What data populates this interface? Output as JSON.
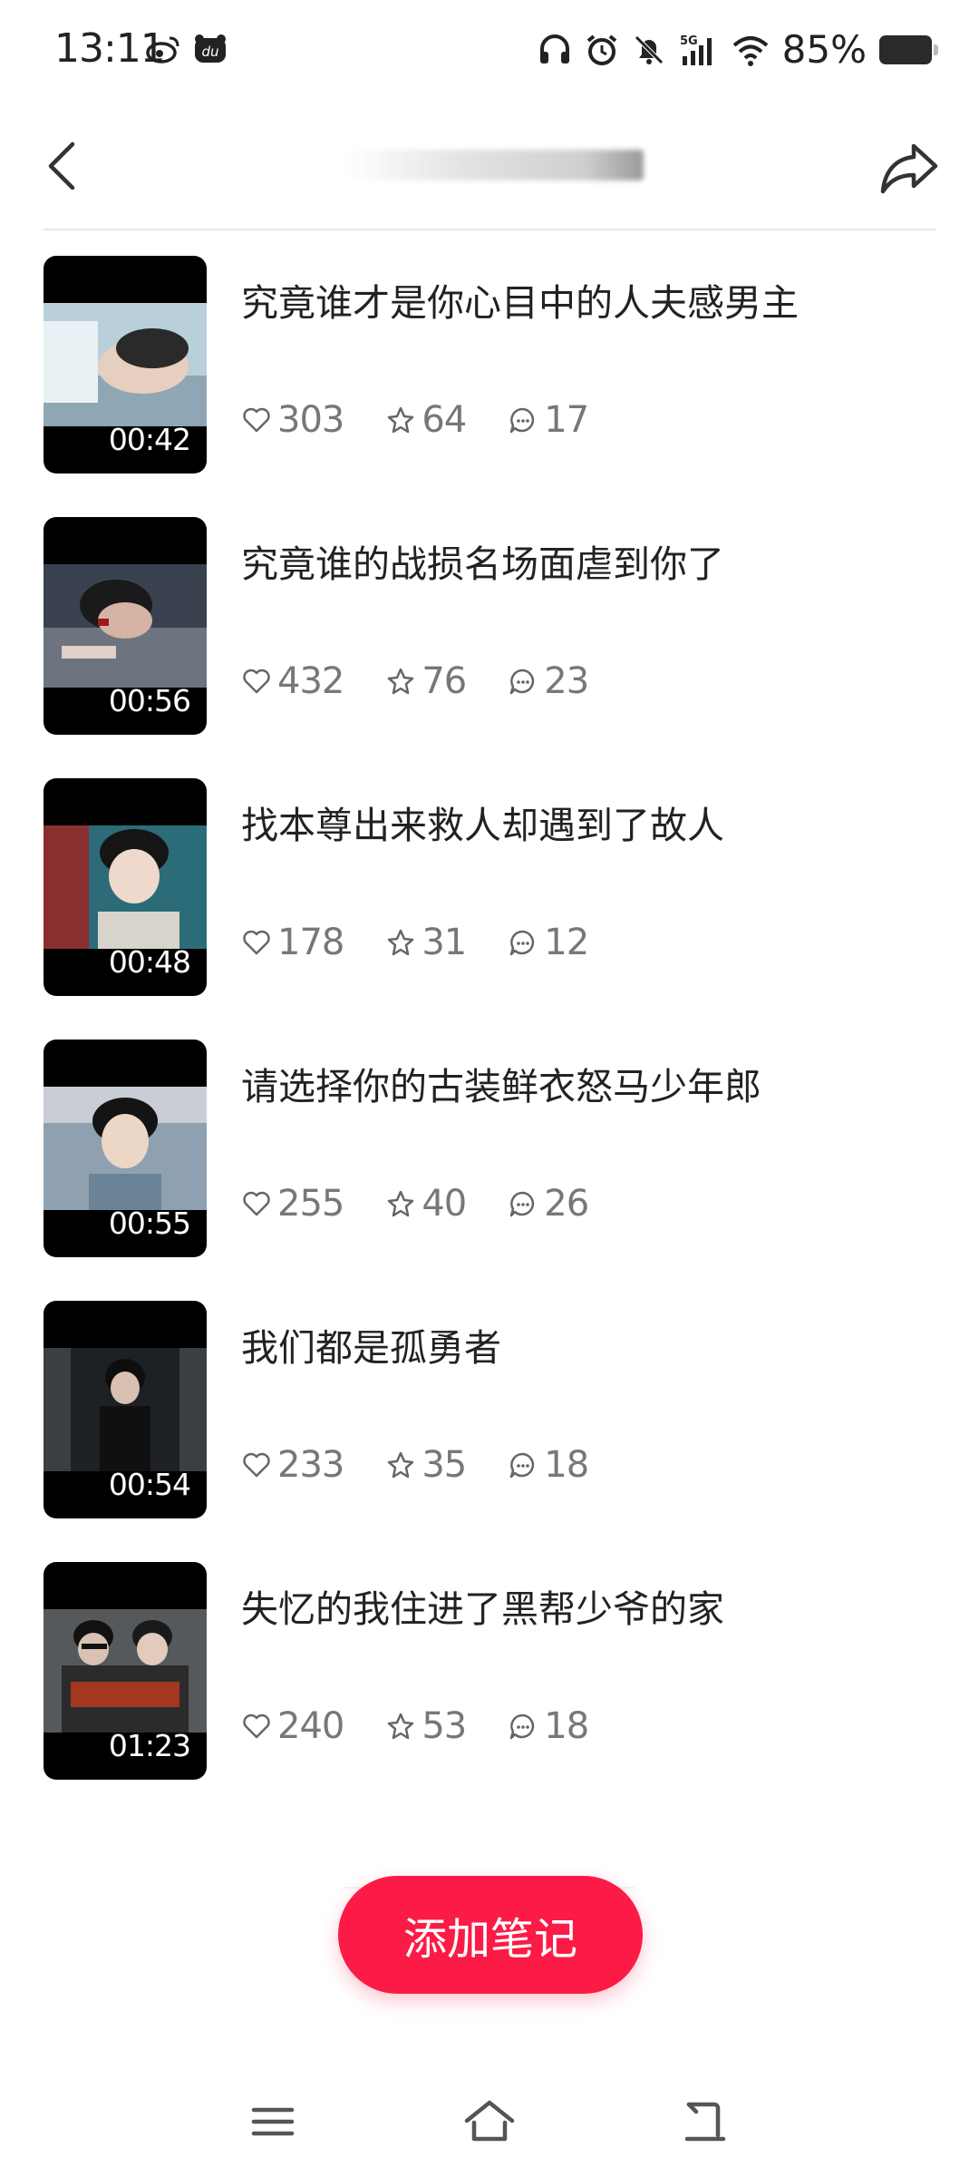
{
  "status_bar": {
    "time": "13:11",
    "battery": "85%",
    "left_icons": [
      "weibo-icon",
      "du-app-icon"
    ],
    "right_icons": [
      "headphones-icon",
      "alarm-icon",
      "mute-icon",
      "signal-5g-icon",
      "wifi-icon",
      "battery-icon"
    ]
  },
  "header": {
    "back_icon": "chevron-left-icon",
    "share_icon": "share-icon"
  },
  "items": [
    {
      "title": "究竟谁才是你心目中的人夫感男主",
      "duration": "00:42",
      "likes": "303",
      "favorites": "64",
      "comments": "17"
    },
    {
      "title": "究竟谁的战损名场面虐到你了",
      "duration": "00:56",
      "likes": "432",
      "favorites": "76",
      "comments": "23"
    },
    {
      "title": "找本尊出来救人却遇到了故人",
      "duration": "00:48",
      "likes": "178",
      "favorites": "31",
      "comments": "12"
    },
    {
      "title": "请选择你的古装鲜衣怒马少年郎",
      "duration": "00:55",
      "likes": "255",
      "favorites": "40",
      "comments": "26"
    },
    {
      "title": "我们都是孤勇者",
      "duration": "00:54",
      "likes": "233",
      "favorites": "35",
      "comments": "18"
    },
    {
      "title": "失忆的我住进了黑帮少爷的家",
      "duration": "01:23",
      "likes": "240",
      "favorites": "53",
      "comments": "18"
    }
  ],
  "add_note_label": "添加笔记",
  "nav": {
    "icons": [
      "menu-icon",
      "home-icon",
      "back-icon"
    ]
  },
  "colors": {
    "accent": "#fc1b47"
  }
}
